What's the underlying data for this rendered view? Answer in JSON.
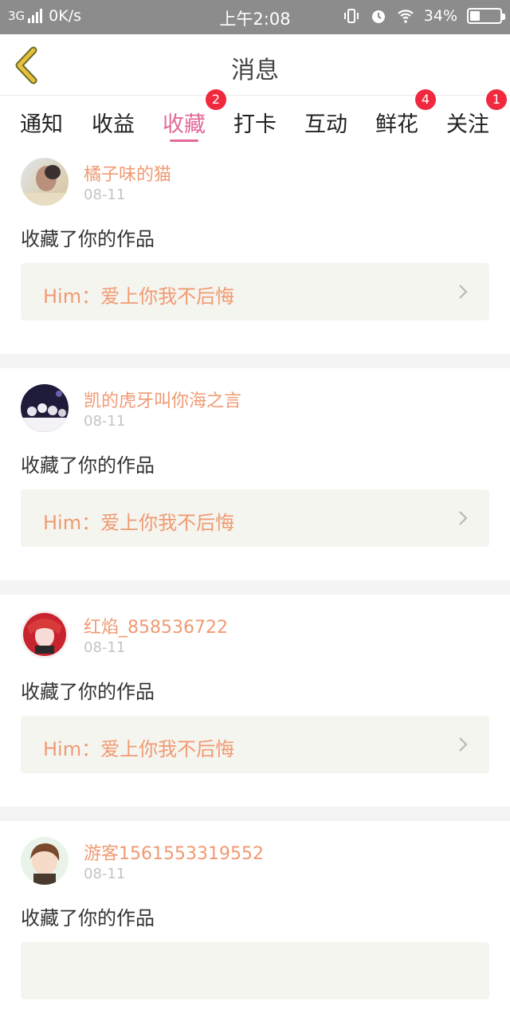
{
  "status_bar": {
    "network": "3G",
    "speed": "0K/s",
    "time": "上午2:08",
    "battery": "34%",
    "battery_level": 0.34
  },
  "header": {
    "title": "消息"
  },
  "tabs": [
    {
      "label": "通知",
      "badge": ""
    },
    {
      "label": "收益",
      "badge": ""
    },
    {
      "label": "收藏",
      "badge": "2",
      "active": true
    },
    {
      "label": "打卡",
      "badge": ""
    },
    {
      "label": "互动",
      "badge": ""
    },
    {
      "label": "鲜花",
      "badge": "4"
    },
    {
      "label": "关注",
      "badge": "1"
    }
  ],
  "feed": [
    {
      "username": "橘子味的猫",
      "date": "08-11",
      "action": "收藏了你的作品",
      "work": "Him：爱上你我不后悔"
    },
    {
      "username": "凯的虎牙叫你海之言",
      "date": "08-11",
      "action": "收藏了你的作品",
      "work": "Him：爱上你我不后悔"
    },
    {
      "username": "红焰_858536722",
      "date": "08-11",
      "action": "收藏了你的作品",
      "work": "Him：爱上你我不后悔"
    },
    {
      "username": "游客1561553319552",
      "date": "08-11",
      "action": "收藏了你的作品",
      "work": ""
    }
  ],
  "colors": {
    "accent": "#e2699b",
    "username": "#f09a73",
    "badge": "#f0293f",
    "status_bar": "#8c8c8c",
    "back_icon": "#e6bf3c"
  }
}
